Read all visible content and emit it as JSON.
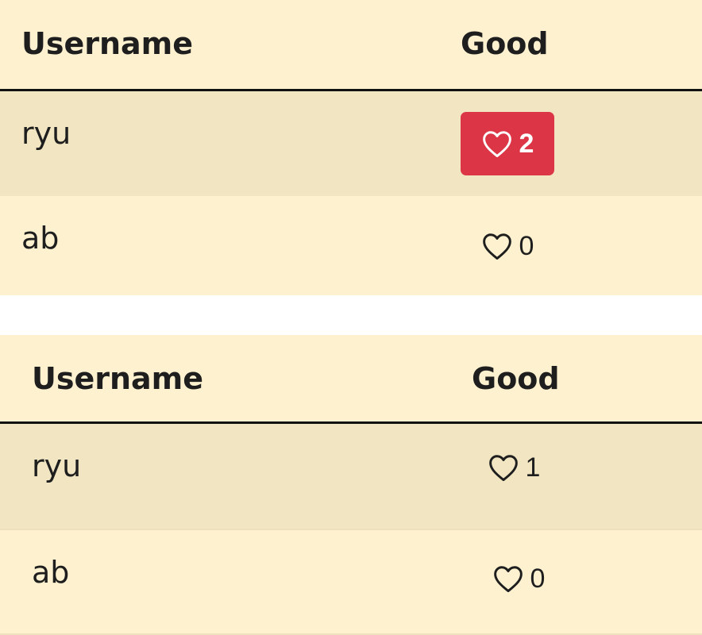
{
  "tables": [
    {
      "headers": {
        "username": "Username",
        "good": "Good"
      },
      "rows": [
        {
          "username": "ryu",
          "good_count": "2",
          "liked": true
        },
        {
          "username": "ab",
          "good_count": "0",
          "liked": false
        }
      ]
    },
    {
      "headers": {
        "username": "Username",
        "good": "Good"
      },
      "rows": [
        {
          "username": "ryu",
          "good_count": "1",
          "liked": false
        },
        {
          "username": "ab",
          "good_count": "0",
          "liked": false
        }
      ]
    }
  ],
  "icons": {
    "like": "heart-outline-icon"
  },
  "colors": {
    "table_bg": "#fdf1cf",
    "striped_row_bg": "#f1e5c2",
    "liked_button_bg": "#dc3545"
  }
}
